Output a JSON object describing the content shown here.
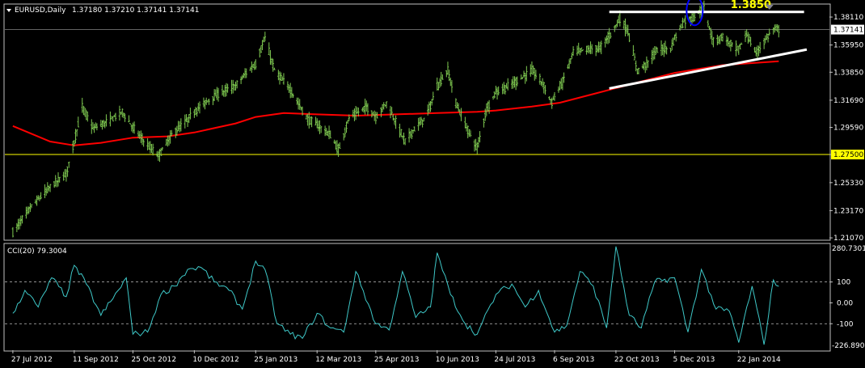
{
  "header": {
    "symbol_label": "EURUSD,Daily",
    "ohlc_label": "1.37180 1.37210 1.37141 1.37141"
  },
  "subheader": {
    "indicator_label": "CCI(20) 79.3004"
  },
  "annotations": {
    "resistance_label": "1.3850"
  },
  "colors": {
    "background": "#000000",
    "frame": "#c0c0c0",
    "bars": "#7ec850",
    "moving_average": "#ff0000",
    "cci_line": "#3ec8c8",
    "support_level": "#ffff00",
    "trend_lines": "#ffffff",
    "highlight_circle": "#0000ff",
    "annotation_text": "#ffff00"
  },
  "icons": {
    "menu": "dropdown-triangle-icon"
  },
  "chart_data": [
    {
      "type": "bar",
      "subtype": "ohlc",
      "symbol": "EURUSD",
      "timeframe": "Daily",
      "x_tick_labels": [
        "27 Jul 2012",
        "11 Sep 2012",
        "25 Oct 2012",
        "10 Dec 2012",
        "25 Jan 2013",
        "12 Mar 2013",
        "25 Apr 2013",
        "10 Jun 2013",
        "24 Jul 2013",
        "6 Sep 2013",
        "22 Oct 2013",
        "5 Dec 2013",
        "22 Jan 2014"
      ],
      "y_tick_labels": [
        "1.38110",
        "1.35950",
        "1.33850",
        "1.31690",
        "1.29590",
        "1.27500",
        "1.25330",
        "1.23170",
        "1.21070"
      ],
      "ylim": [
        1.2095,
        1.3905
      ],
      "current_price": 1.37141,
      "current_price_label": "1.37141",
      "horizontal_level": 1.275,
      "horizontal_level_label": "1.27500",
      "resistance": 1.385,
      "price_path": [
        [
          "2012-07-27",
          1.215
        ],
        [
          "2012-08-10",
          1.235
        ],
        [
          "2012-08-24",
          1.25
        ],
        [
          "2012-09-05",
          1.26
        ],
        [
          "2012-09-11",
          1.285
        ],
        [
          "2012-09-17",
          1.312
        ],
        [
          "2012-09-25",
          1.295
        ],
        [
          "2012-10-05",
          1.3
        ],
        [
          "2012-10-17",
          1.308
        ],
        [
          "2012-10-25",
          1.296
        ],
        [
          "2012-11-05",
          1.282
        ],
        [
          "2012-11-13",
          1.274
        ],
        [
          "2012-11-23",
          1.29
        ],
        [
          "2012-12-05",
          1.302
        ],
        [
          "2012-12-14",
          1.312
        ],
        [
          "2012-12-28",
          1.322
        ],
        [
          "2013-01-10",
          1.328
        ],
        [
          "2013-01-18",
          1.338
        ],
        [
          "2013-01-25",
          1.345
        ],
        [
          "2013-02-01",
          1.365
        ],
        [
          "2013-02-08",
          1.34
        ],
        [
          "2013-02-20",
          1.325
        ],
        [
          "2013-03-05",
          1.302
        ],
        [
          "2013-03-12",
          1.298
        ],
        [
          "2013-03-22",
          1.29
        ],
        [
          "2013-03-28",
          1.278
        ],
        [
          "2013-04-05",
          1.303
        ],
        [
          "2013-04-18",
          1.312
        ],
        [
          "2013-04-25",
          1.304
        ],
        [
          "2013-05-03",
          1.315
        ],
        [
          "2013-05-10",
          1.3
        ],
        [
          "2013-05-17",
          1.285
        ],
        [
          "2013-05-24",
          1.295
        ],
        [
          "2013-05-31",
          1.302
        ],
        [
          "2013-06-06",
          1.315
        ],
        [
          "2013-06-10",
          1.328
        ],
        [
          "2013-06-18",
          1.34
        ],
        [
          "2013-06-24",
          1.315
        ],
        [
          "2013-07-02",
          1.296
        ],
        [
          "2013-07-10",
          1.28
        ],
        [
          "2013-07-17",
          1.31
        ],
        [
          "2013-07-24",
          1.323
        ],
        [
          "2013-08-01",
          1.327
        ],
        [
          "2013-08-12",
          1.334
        ],
        [
          "2013-08-20",
          1.34
        ],
        [
          "2013-08-28",
          1.33
        ],
        [
          "2013-09-04",
          1.315
        ],
        [
          "2013-09-06",
          1.32
        ],
        [
          "2013-09-12",
          1.331
        ],
        [
          "2013-09-20",
          1.354
        ],
        [
          "2013-09-30",
          1.356
        ],
        [
          "2013-10-10",
          1.357
        ],
        [
          "2013-10-18",
          1.368
        ],
        [
          "2013-10-22",
          1.375
        ],
        [
          "2013-10-25",
          1.38
        ],
        [
          "2013-10-31",
          1.37
        ],
        [
          "2013-11-07",
          1.34
        ],
        [
          "2013-11-14",
          1.345
        ],
        [
          "2013-11-22",
          1.356
        ],
        [
          "2013-12-02",
          1.357
        ],
        [
          "2013-12-05",
          1.365
        ],
        [
          "2013-12-12",
          1.378
        ],
        [
          "2013-12-18",
          1.38
        ],
        [
          "2013-12-27",
          1.388
        ],
        [
          "2014-01-03",
          1.362
        ],
        [
          "2014-01-10",
          1.366
        ],
        [
          "2014-01-16",
          1.36
        ],
        [
          "2014-01-22",
          1.356
        ],
        [
          "2014-01-28",
          1.368
        ],
        [
          "2014-02-04",
          1.353
        ],
        [
          "2014-02-10",
          1.362
        ],
        [
          "2014-02-17",
          1.372
        ],
        [
          "2014-02-21",
          1.3714
        ]
      ],
      "moving_average": [
        [
          "2012-07-27",
          1.297
        ],
        [
          "2012-08-24",
          1.285
        ],
        [
          "2012-09-11",
          1.282
        ],
        [
          "2012-10-01",
          1.284
        ],
        [
          "2012-10-25",
          1.288
        ],
        [
          "2012-11-20",
          1.289
        ],
        [
          "2012-12-10",
          1.292
        ],
        [
          "2013-01-10",
          1.299
        ],
        [
          "2013-01-25",
          1.304
        ],
        [
          "2013-02-15",
          1.307
        ],
        [
          "2013-03-12",
          1.306
        ],
        [
          "2013-04-10",
          1.305
        ],
        [
          "2013-05-10",
          1.306
        ],
        [
          "2013-06-10",
          1.307
        ],
        [
          "2013-07-10",
          1.308
        ],
        [
          "2013-07-24",
          1.309
        ],
        [
          "2013-08-20",
          1.312
        ],
        [
          "2013-09-10",
          1.315
        ],
        [
          "2013-10-10",
          1.323
        ],
        [
          "2013-11-05",
          1.33
        ],
        [
          "2013-12-05",
          1.338
        ],
        [
          "2014-01-10",
          1.344
        ],
        [
          "2014-02-21",
          1.347
        ]
      ],
      "trend_lines": [
        {
          "name": "resistance",
          "from": [
            "2013-10-17",
            1.385
          ],
          "to": [
            "2014-03-12",
            1.385
          ]
        },
        {
          "name": "support",
          "from": [
            "2013-10-17",
            1.326
          ],
          "to": [
            "2014-03-14",
            1.356
          ]
        }
      ],
      "highlight": {
        "date": "2013-12-20",
        "price": 1.386
      }
    },
    {
      "type": "line",
      "name": "CCI(20)",
      "value": 79.3004,
      "ylim": [
        -226.8905,
        280.7301
      ],
      "ylim_labels": [
        "280.7301",
        "-226.8905"
      ],
      "levels": [
        100,
        -100
      ],
      "y_tick_labels": [
        "100",
        "0.00",
        "-100"
      ],
      "x": [
        "2012-07-27",
        "2012-08-05",
        "2012-08-15",
        "2012-08-25",
        "2012-09-05",
        "2012-09-11",
        "2012-09-20",
        "2012-10-01",
        "2012-10-10",
        "2012-10-20",
        "2012-10-25",
        "2012-11-05",
        "2012-11-15",
        "2012-11-25",
        "2012-12-05",
        "2012-12-15",
        "2012-12-25",
        "2013-01-05",
        "2013-01-15",
        "2013-01-25",
        "2013-02-01",
        "2013-02-10",
        "2013-02-20",
        "2013-03-01",
        "2013-03-12",
        "2013-03-22",
        "2013-04-01",
        "2013-04-10",
        "2013-04-25",
        "2013-05-05",
        "2013-05-15",
        "2013-05-25",
        "2013-06-05",
        "2013-06-10",
        "2013-06-20",
        "2013-07-01",
        "2013-07-10",
        "2013-07-24",
        "2013-08-05",
        "2013-08-15",
        "2013-08-25",
        "2013-09-06",
        "2013-09-15",
        "2013-09-25",
        "2013-10-05",
        "2013-10-15",
        "2013-10-22",
        "2013-11-01",
        "2013-11-10",
        "2013-11-20",
        "2013-12-05",
        "2013-12-15",
        "2013-12-25",
        "2014-01-05",
        "2014-01-15",
        "2014-01-22",
        "2014-02-01",
        "2014-02-10",
        "2014-02-17",
        "2014-02-21"
      ],
      "values": [
        -50,
        60,
        -20,
        120,
        30,
        180,
        90,
        -60,
        20,
        120,
        -150,
        -140,
        40,
        80,
        160,
        170,
        100,
        60,
        -30,
        200,
        160,
        -100,
        -150,
        -170,
        -50,
        -120,
        -140,
        150,
        -100,
        -130,
        150,
        -70,
        -20,
        240,
        40,
        -100,
        -150,
        40,
        90,
        -20,
        60,
        -140,
        -110,
        150,
        80,
        -120,
        270,
        -60,
        -120,
        100,
        120,
        -140,
        160,
        -30,
        -40,
        -190,
        80,
        -200,
        110,
        79.3
      ]
    }
  ]
}
